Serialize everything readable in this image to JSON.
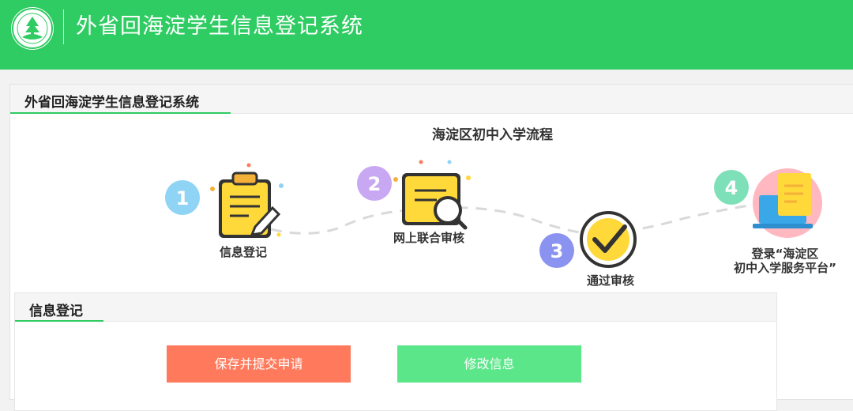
{
  "header": {
    "title": "外省回海淀学生信息登记系统"
  },
  "panel": {
    "title": "外省回海淀学生信息登记系统",
    "flow_title": "海淀区初中入学流程"
  },
  "steps": [
    {
      "number": "1",
      "label": "信息登记"
    },
    {
      "number": "2",
      "label": "网上联合审核"
    },
    {
      "number": "3",
      "label": "通过审核"
    },
    {
      "number": "4",
      "label_line1": "登录“海淀区",
      "label_line2": "初中入学服务平台”"
    }
  ],
  "subpanel": {
    "title": "信息登记",
    "save_button": "保存并提交申请",
    "edit_button": "修改信息"
  },
  "colors": {
    "brand_green": "#2ecc62",
    "save_button": "#ff7a5c",
    "edit_button": "#5be68a"
  }
}
